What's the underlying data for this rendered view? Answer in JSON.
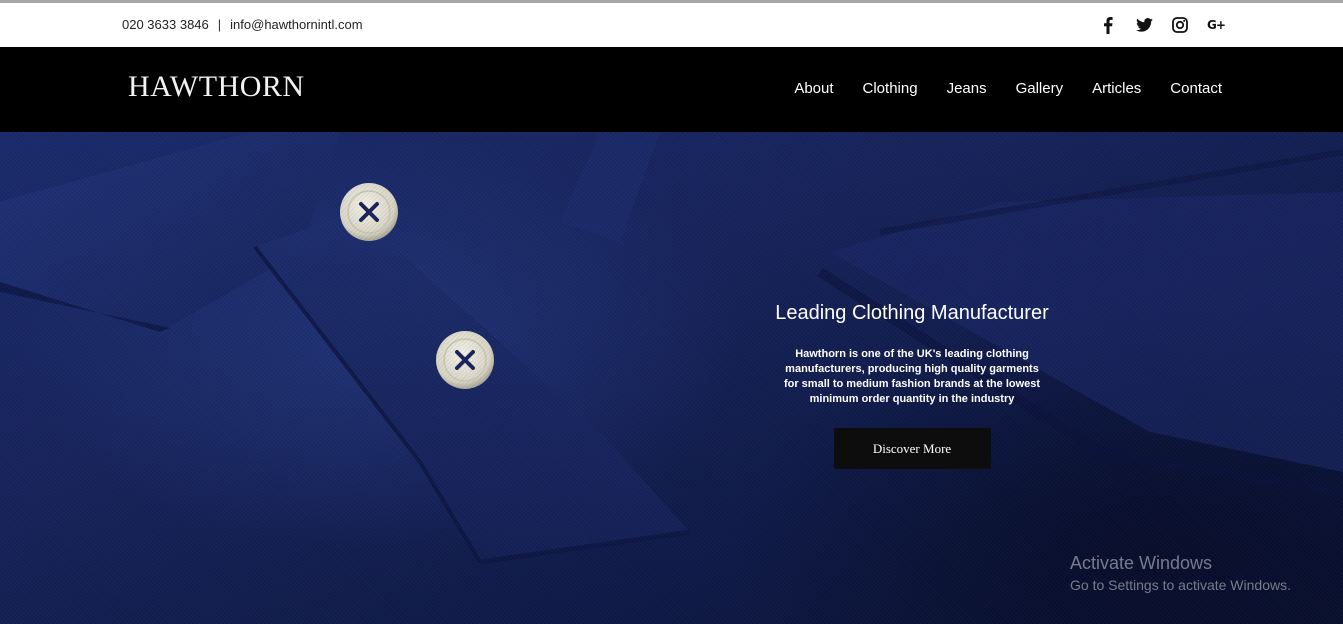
{
  "topbar": {
    "phone": "020 3633 3846",
    "separator": "|",
    "email": "info@hawthornintl.com",
    "social": [
      "facebook-icon",
      "twitter-icon",
      "instagram-icon",
      "google-plus-icon"
    ],
    "gplus_glyph": "G+"
  },
  "nav": {
    "logo": "HAWTHORN",
    "items": [
      "About",
      "Clothing",
      "Jeans",
      "Gallery",
      "Articles",
      "Contact"
    ]
  },
  "hero": {
    "title": "Leading Clothing Manufacturer",
    "text": "Hawthorn is one of the UK's leading clothing manufacturers, producing high quality garments for small to medium fashion brands at the lowest minimum order quantity in the industry",
    "cta": "Discover More"
  },
  "watermark": {
    "line1": "Activate Windows",
    "line2": "Go to Settings to activate Windows."
  },
  "colors": {
    "topbar_bg": "#ffffff",
    "nav_bg": "#000000",
    "hero_blue": "#17245c",
    "cta_bg": "#0d0d0d"
  }
}
